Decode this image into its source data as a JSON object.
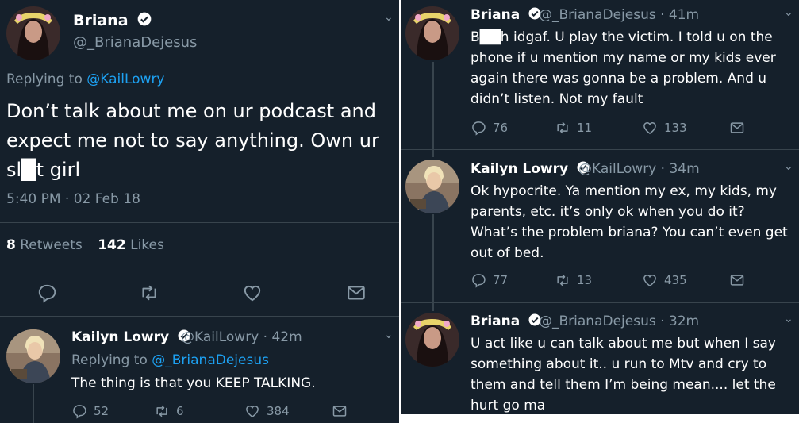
{
  "main_tweet": {
    "name": "Briana",
    "handle": "@_BrianaDejesus",
    "replying_label": "Replying to",
    "replying_to": "@KailLowry",
    "text": "Don’t talk about me on ur podcast and expect me not to say anything. Own ur sl█t girl",
    "timestamp": "5:40 PM · 02 Feb 18",
    "retweets_count": "8",
    "retweets_label": "Retweets",
    "likes_count": "142",
    "likes_label": "Likes"
  },
  "left_reply": {
    "name": "Kailyn Lowry",
    "handle": "@KailLowry · 42m",
    "replying_label": "Replying to",
    "replying_to": "@_BrianaDejesus",
    "text": "The thing is that you KEEP TALKING.",
    "replies": "52",
    "retweets": "6",
    "likes": "384"
  },
  "right_thread": [
    {
      "name": "Briana",
      "handle": "@_BrianaDejesus · 41m",
      "text": "B██h idgaf. U play the victim. I told u on the phone if u mention my name or my kids ever again there was gonna be a problem. And u didn’t listen. Not my fault",
      "replies": "76",
      "retweets": "11",
      "likes": "133"
    },
    {
      "name": "Kailyn Lowry",
      "handle": "@KailLowry · 34m",
      "text": "Ok hypocrite. Ya mention my ex, my kids, my parents, etc. it’s only ok when you do it? What’s the problem briana? You can’t even get out of bed.",
      "replies": "77",
      "retweets": "13",
      "likes": "435"
    },
    {
      "name": "Briana",
      "handle": "@_BrianaDejesus · 32m",
      "text": "U act like u can talk about me but when I say something about it.. u run to Mtv and cry to them and tell them I’m being mean.... let the hurt go ma"
    }
  ],
  "colors": {
    "background": "#15202b",
    "text": "#ffffff",
    "muted": "#8899a6",
    "link": "#1da1f2",
    "verified": "#ffffff"
  },
  "icons": [
    "verified-badge-icon",
    "chevron-down-icon",
    "reply-icon",
    "retweet-icon",
    "like-icon",
    "dm-icon"
  ]
}
